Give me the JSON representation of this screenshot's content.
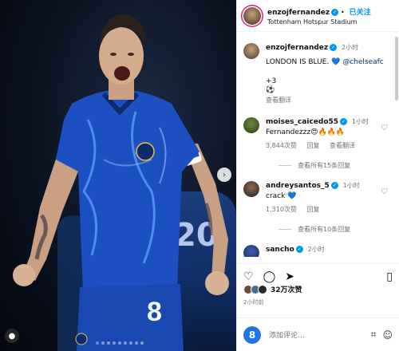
{
  "post": {
    "username": "enzojfernandez",
    "follow_label": "已关注",
    "location": "Tottenham Hotspur Stadium",
    "caption": {
      "username": "enzojfernandez",
      "time": "2小时",
      "text": "LONDON IS BLUE.",
      "emoji": "💙",
      "mention": "@chelseafc",
      "extra_count": "+3",
      "translate": "查看翻译"
    },
    "photo": {
      "shirt_number": "8",
      "background_number": "20",
      "dots": 9,
      "active_dot": 0
    }
  },
  "comments": [
    {
      "username": "moises_caicedo55",
      "time": "1小时",
      "text": "Fernandezzz",
      "emojis": "😍🔥🔥🔥",
      "likes": "3,844次赞",
      "reply": "回复",
      "translate": "查看翻译",
      "view_replies": "查看所有15条回复"
    },
    {
      "username": "andreysantos_5",
      "time": "1小时",
      "text": "crack",
      "emojis": "💙",
      "likes": "1,310次赞",
      "reply": "回复",
      "view_replies": "查看所有10条回复"
    },
    {
      "username": "sancho",
      "time": "2小时"
    }
  ],
  "footer": {
    "likes": "32万次赞",
    "post_time": "2小时前",
    "add_comment_placeholder": "添加评论…",
    "user_initial": "8"
  },
  "colors": {
    "accent": "#0095f6",
    "chelsea_blue": "#1c4fbf",
    "heart_blue": "#1d74e8"
  }
}
